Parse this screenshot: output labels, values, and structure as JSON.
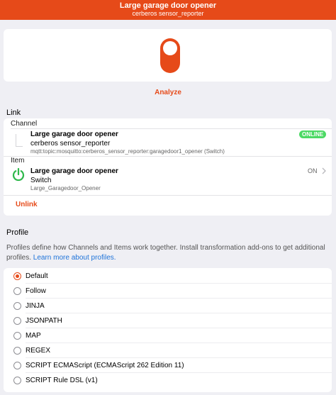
{
  "header": {
    "title": "Large garage door opener",
    "subtitle": "cerberos sensor_reporter"
  },
  "toggle": {
    "state": "on",
    "color": "#e64a19"
  },
  "analyze_label": "Analyze",
  "link": {
    "section_label": "Link",
    "channel_label": "Channel",
    "channel": {
      "title": "Large garage door opener",
      "thing": "cerberos sensor_reporter",
      "uid": "mqtt:topic:mosquitto:cerberos_sensor_reporter:garagedoor1_opener (Switch)",
      "status": "ONLINE",
      "status_color": "#4cd964"
    },
    "item_label": "Item",
    "item": {
      "icon": "power-icon",
      "title": "Large garage door opener",
      "type": "Switch",
      "name": "Large_Garagedoor_Opener",
      "state": "ON"
    },
    "unlink_label": "Unlink"
  },
  "profile": {
    "section_label": "Profile",
    "description": "Profiles define how Channels and Items work together. Install transformation add-ons to get additional profiles.",
    "learn_more": "Learn more about profiles.",
    "options": [
      {
        "label": "Default",
        "selected": true
      },
      {
        "label": "Follow",
        "selected": false
      },
      {
        "label": "JINJA",
        "selected": false
      },
      {
        "label": "JSONPATH",
        "selected": false
      },
      {
        "label": "MAP",
        "selected": false
      },
      {
        "label": "REGEX",
        "selected": false
      },
      {
        "label": "SCRIPT ECMAScript (ECMAScript 262 Edition 11)",
        "selected": false
      },
      {
        "label": "SCRIPT Rule DSL (v1)",
        "selected": false
      }
    ]
  }
}
